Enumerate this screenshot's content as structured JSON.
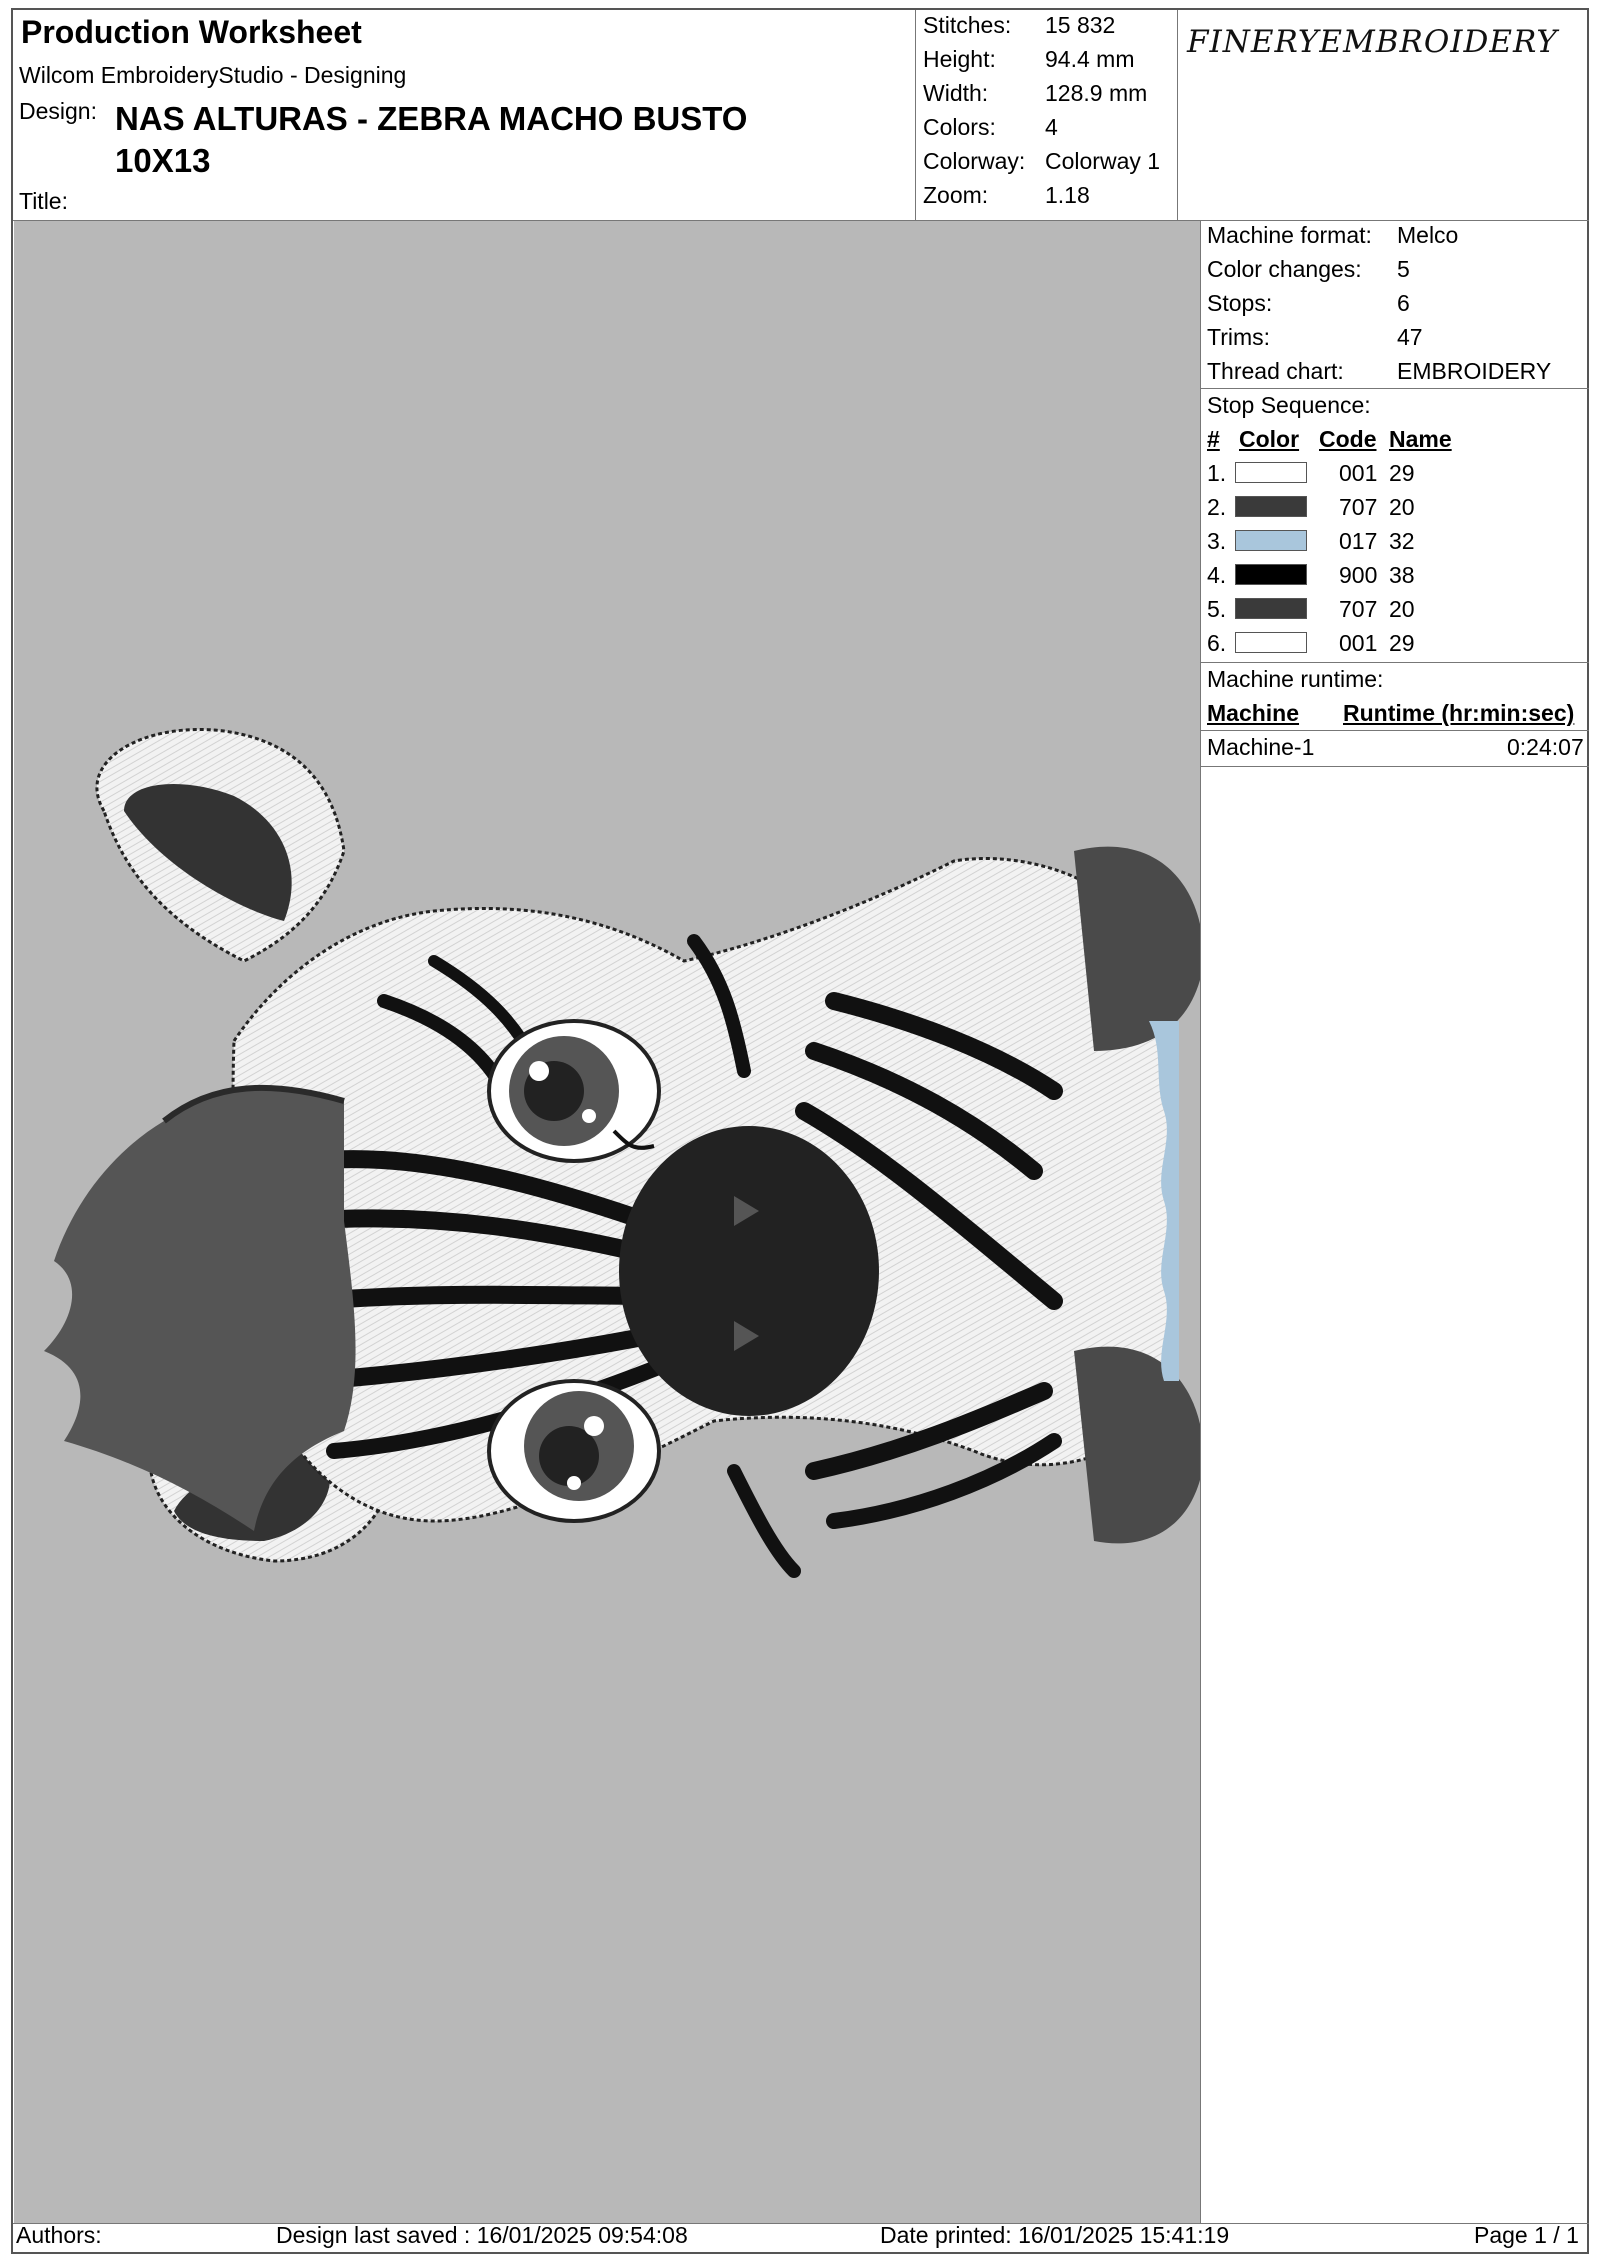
{
  "header": {
    "title": "Production Worksheet",
    "software": "Wilcom EmbroideryStudio - Designing",
    "design_label": "Design:",
    "design_value_line1": "NAS ALTURAS - ZEBRA MACHO BUSTO",
    "design_value_line2": "10X13",
    "title_label": "Title:"
  },
  "stats": [
    {
      "label": "Stitches:",
      "value": "15 832"
    },
    {
      "label": "Height:",
      "value": "94.4 mm"
    },
    {
      "label": "Width:",
      "value": "128.9 mm"
    },
    {
      "label": "Colors:",
      "value": "4"
    },
    {
      "label": "Colorway:",
      "value": "Colorway 1"
    },
    {
      "label": "Zoom:",
      "value": "1.18"
    }
  ],
  "logo": "FINERYEMBROIDERY",
  "machine": [
    {
      "label": "Machine format:",
      "value": "Melco"
    },
    {
      "label": "Color changes:",
      "value": "5"
    },
    {
      "label": "Stops:",
      "value": "6"
    },
    {
      "label": "Trims:",
      "value": "47"
    },
    {
      "label": "Thread chart:",
      "value": "EMBROIDERY"
    }
  ],
  "stop_sequence": {
    "title": "Stop Sequence:",
    "headers": {
      "num": "#",
      "color": "Color",
      "code": "Code",
      "name": "Name"
    },
    "rows": [
      {
        "num": "1.",
        "color": "#ffffff",
        "code": "001",
        "name": "29"
      },
      {
        "num": "2.",
        "color": "#3a3a3a",
        "code": "707",
        "name": "20"
      },
      {
        "num": "3.",
        "color": "#a9c6dc",
        "code": "017",
        "name": "32"
      },
      {
        "num": "4.",
        "color": "#000000",
        "code": "900",
        "name": "38"
      },
      {
        "num": "5.",
        "color": "#3a3a3a",
        "code": "707",
        "name": "20"
      },
      {
        "num": "6.",
        "color": "#ffffff",
        "code": "001",
        "name": "29"
      }
    ]
  },
  "runtime": {
    "title": "Machine runtime:",
    "col_machine": "Machine",
    "col_runtime": "Runtime (hr:min:sec)",
    "machine": "Machine-1",
    "time": "0:24:07"
  },
  "footer": {
    "authors": "Authors:",
    "saved": "Design last saved : 16/01/2025 09:54:08",
    "printed": "Date printed: 16/01/2025 15:41:19",
    "page": "Page 1 / 1"
  }
}
